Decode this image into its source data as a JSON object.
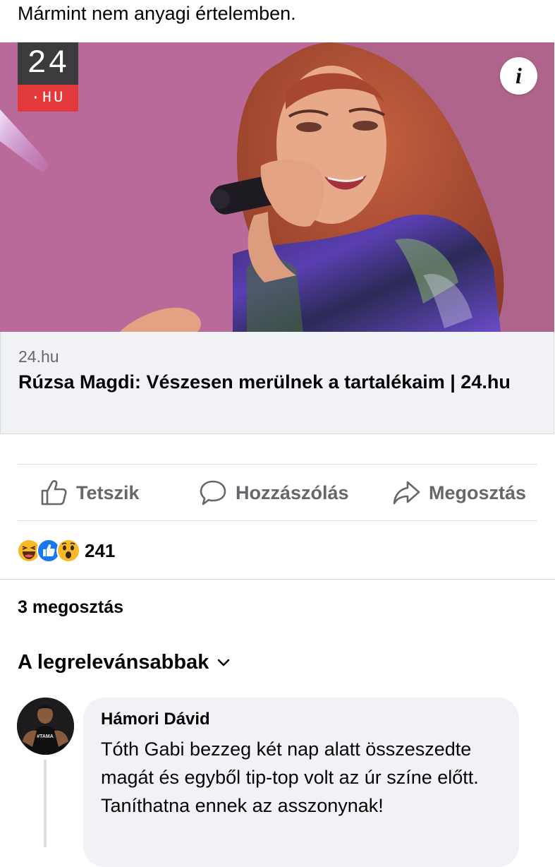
{
  "post": {
    "text": "Mármint nem anyagi értelemben."
  },
  "link": {
    "logo_top": "24",
    "logo_bottom": "·HU",
    "info_icon": "i",
    "domain": "24.hu",
    "title": "Rúzsa Magdi: Vészesen merülnek a tartalékaim | 24.hu"
  },
  "actions": {
    "like": "Tetszik",
    "comment": "Hozzászólás",
    "share": "Megosztás"
  },
  "reactions": {
    "icons": [
      "haha-icon",
      "like-icon",
      "wow-icon"
    ],
    "count": "241"
  },
  "shares": "3 megosztás",
  "sort": {
    "label": "A legrelevánsabbak"
  },
  "comment": {
    "author": "Hámori Dávid",
    "text": "Tóth Gabi bezzeg két nap alatt összeszedte magát és egyből tip-top volt az úr színe előtt. Taníthatna ennek az asszonynak!",
    "shirt_text": "#TAMA"
  },
  "colors": {
    "secondary_text": "#65676b",
    "like_blue": "#1877f2",
    "reaction_yellow": "#f7b928",
    "bubble_bg": "#f0f2f5",
    "divider": "#dadde1",
    "logo_dark": "#3b3b3d",
    "logo_red": "#e2393a"
  }
}
